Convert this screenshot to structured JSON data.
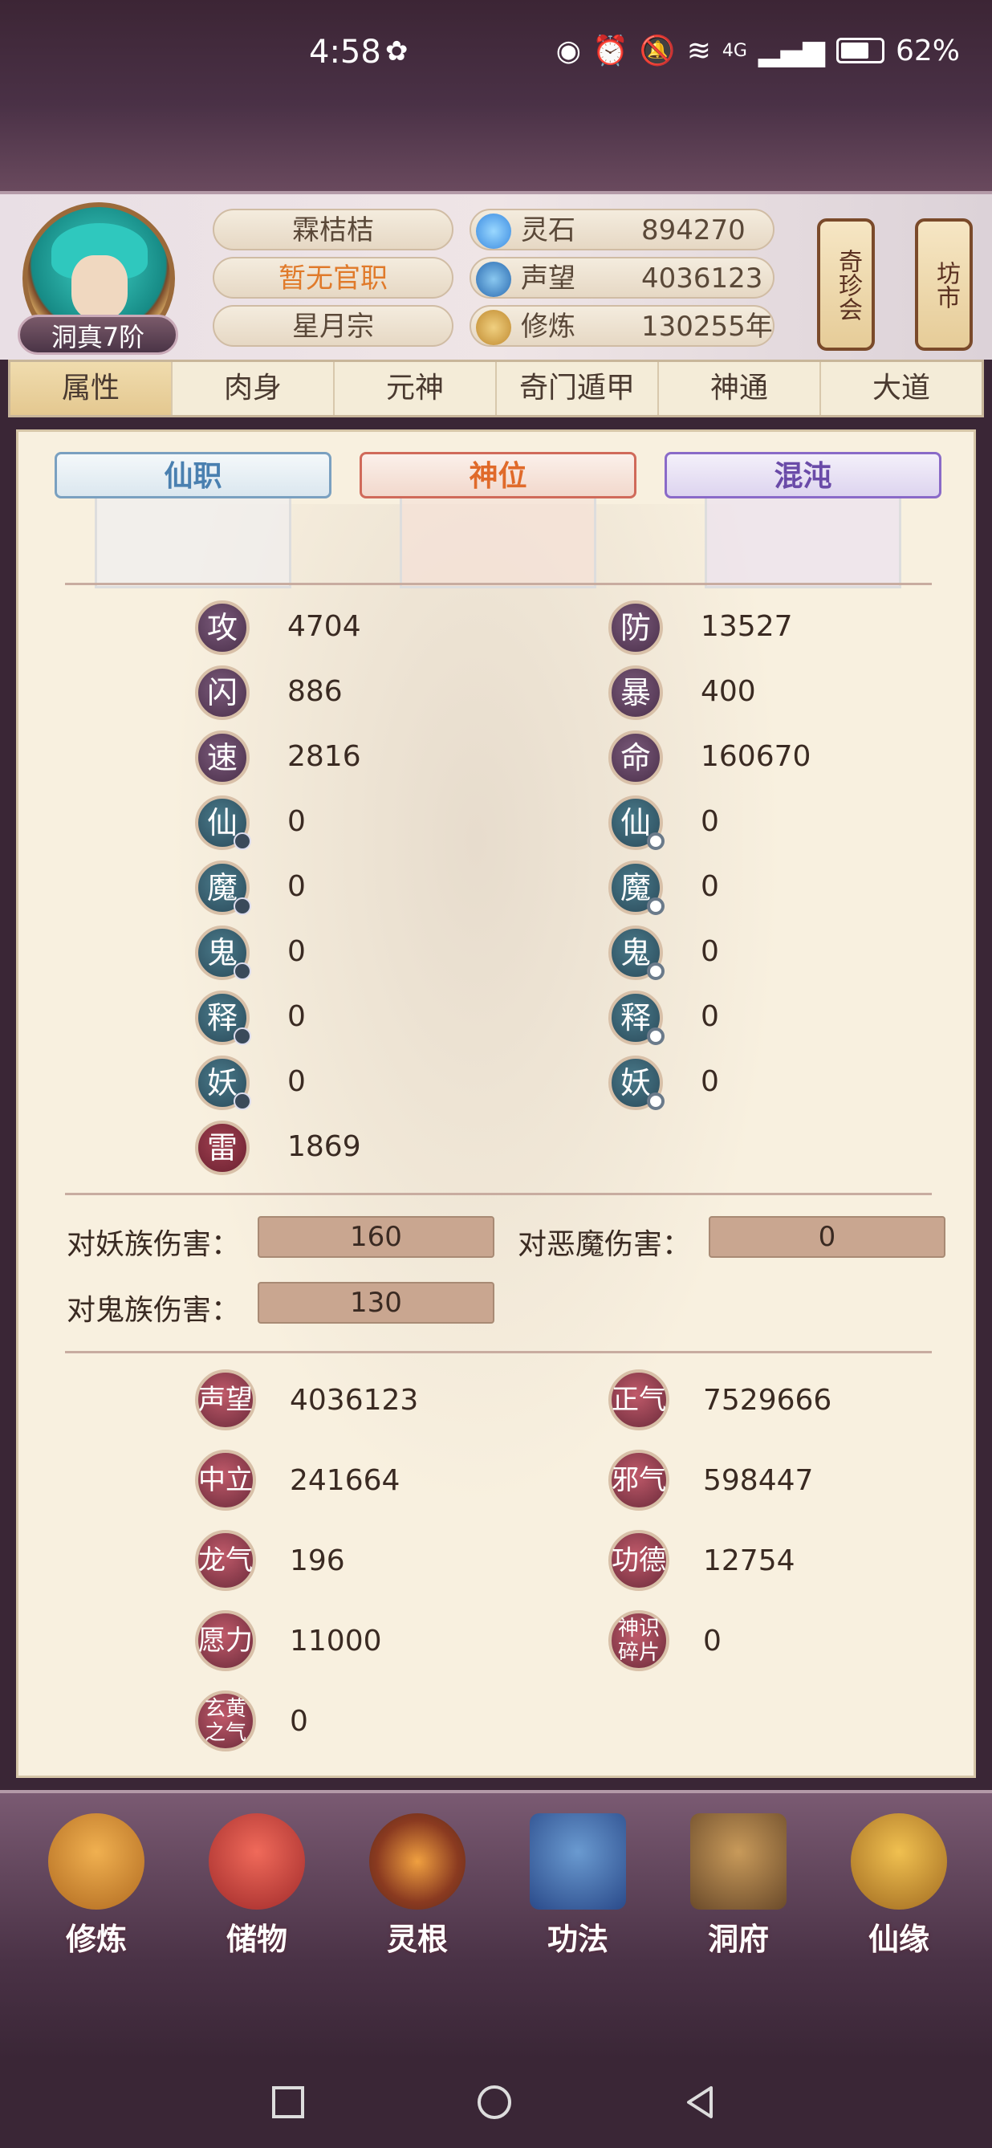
{
  "status_bar": {
    "time": "4:58",
    "battery": "62%",
    "network": "4G"
  },
  "player": {
    "name": "霖桔桔",
    "official_post": "暂无官职",
    "sect": "星月宗",
    "rank": "洞真7阶",
    "official_post_color": "#e07a2a"
  },
  "resources": [
    {
      "label": "灵石",
      "value": "894270",
      "icon": "spirit-stone-icon"
    },
    {
      "label": "声望",
      "value": "4036123",
      "icon": "reputation-icon"
    },
    {
      "label": "修炼",
      "value": "130255年",
      "icon": "cultivation-icon"
    }
  ],
  "shortcuts": {
    "treasure": "奇珍会",
    "market": "坊市"
  },
  "tabs": [
    "属性",
    "肉身",
    "元神",
    "奇门遁甲",
    "神通",
    "大道"
  ],
  "frames": {
    "xian_zhi": "仙职",
    "shen_wei": "神位",
    "hun_dun": "混沌"
  },
  "left_stats": [
    {
      "label": "攻",
      "value": "4704"
    },
    {
      "label": "闪",
      "value": "886"
    },
    {
      "label": "速",
      "value": "2816"
    },
    {
      "label": "仙",
      "value": "0"
    },
    {
      "label": "魔",
      "value": "0"
    },
    {
      "label": "鬼",
      "value": "0"
    },
    {
      "label": "释",
      "value": "0"
    },
    {
      "label": "妖",
      "value": "0"
    },
    {
      "label": "雷",
      "value": "1869"
    }
  ],
  "right_stats": [
    {
      "label": "防",
      "value": "13527"
    },
    {
      "label": "暴",
      "value": "400"
    },
    {
      "label": "命",
      "value": "160670"
    },
    {
      "label": "仙",
      "value": "0"
    },
    {
      "label": "魔",
      "value": "0"
    },
    {
      "label": "鬼",
      "value": "0"
    },
    {
      "label": "释",
      "value": "0"
    },
    {
      "label": "妖",
      "value": "0"
    }
  ],
  "damage": {
    "vs_demon_race_label": "对妖族伤害：",
    "vs_demon_race_value": "160",
    "vs_evil_label": "对恶魔伤害：",
    "vs_evil_value": "0",
    "vs_ghost_label": "对鬼族伤害：",
    "vs_ghost_value": "130"
  },
  "bottom_stats": [
    {
      "label": "声望",
      "value": "4036123"
    },
    {
      "label": "正气",
      "value": "7529666"
    },
    {
      "label": "中立",
      "value": "241664"
    },
    {
      "label": "邪气",
      "value": "598447"
    },
    {
      "label": "龙气",
      "value": "196"
    },
    {
      "label": "功德",
      "value": "12754"
    },
    {
      "label": "愿力",
      "value": "11000"
    },
    {
      "label": "神识碎片",
      "value": "0"
    },
    {
      "label": "玄黄之气",
      "value": "0"
    }
  ],
  "bottom_nav": [
    "修炼",
    "储物",
    "灵根",
    "功法",
    "洞府",
    "仙缘"
  ]
}
